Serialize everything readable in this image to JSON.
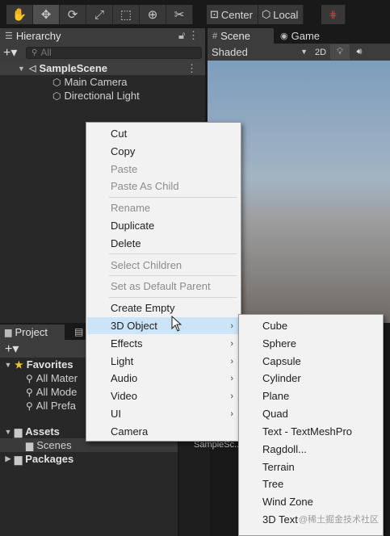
{
  "toolbar": {
    "tools": [
      "hand-icon",
      "move-icon",
      "rotate-icon",
      "scale-icon",
      "rect-icon",
      "transform-icon",
      "custom-tool-icon"
    ],
    "pivot_label": "Center",
    "space_label": "Local"
  },
  "hierarchy": {
    "tab_label": "Hierarchy",
    "search_placeholder": "All",
    "scene_name": "SampleScene",
    "items": [
      "Main Camera",
      "Directional Light"
    ]
  },
  "scene_view": {
    "tab_scene": "Scene",
    "tab_game": "Game",
    "shading_mode": "Shaded",
    "mode_2d": "2D"
  },
  "project": {
    "tab_label": "Project",
    "favorites_label": "Favorites",
    "favorites": [
      "All Mater",
      "All Mode",
      "All Prefa"
    ],
    "assets_label": "Assets",
    "scenes_label": "Scenes",
    "packages_label": "Packages",
    "asset_item": "SampleSc..."
  },
  "context_menu": {
    "items": [
      {
        "label": "Cut",
        "enabled": true
      },
      {
        "label": "Copy",
        "enabled": true
      },
      {
        "label": "Paste",
        "enabled": false
      },
      {
        "label": "Paste As Child",
        "enabled": false
      },
      {
        "label": "Rename",
        "enabled": false
      },
      {
        "label": "Duplicate",
        "enabled": true
      },
      {
        "label": "Delete",
        "enabled": true
      },
      {
        "label": "Select Children",
        "enabled": false
      },
      {
        "label": "Set as Default Parent",
        "enabled": false
      },
      {
        "label": "Create Empty",
        "enabled": true
      },
      {
        "label": "3D Object",
        "enabled": true,
        "submenu": true,
        "highlighted": true
      },
      {
        "label": "Effects",
        "enabled": true,
        "submenu": true
      },
      {
        "label": "Light",
        "enabled": true,
        "submenu": true
      },
      {
        "label": "Audio",
        "enabled": true,
        "submenu": true
      },
      {
        "label": "Video",
        "enabled": true,
        "submenu": true
      },
      {
        "label": "UI",
        "enabled": true,
        "submenu": true
      },
      {
        "label": "Camera",
        "enabled": true
      }
    ]
  },
  "submenu_3d_object": {
    "items": [
      "Cube",
      "Sphere",
      "Capsule",
      "Cylinder",
      "Plane",
      "Quad",
      "Text - TextMeshPro",
      "Ragdoll...",
      "Terrain",
      "Tree",
      "Wind Zone",
      "3D Text"
    ]
  },
  "watermark": "@稀土掘金技术社区",
  "colors": {
    "menu_bg": "#f2f2f2",
    "menu_highlight": "#cce4f7",
    "panel_bg": "#282828",
    "favorite_star": "#f2c230"
  }
}
